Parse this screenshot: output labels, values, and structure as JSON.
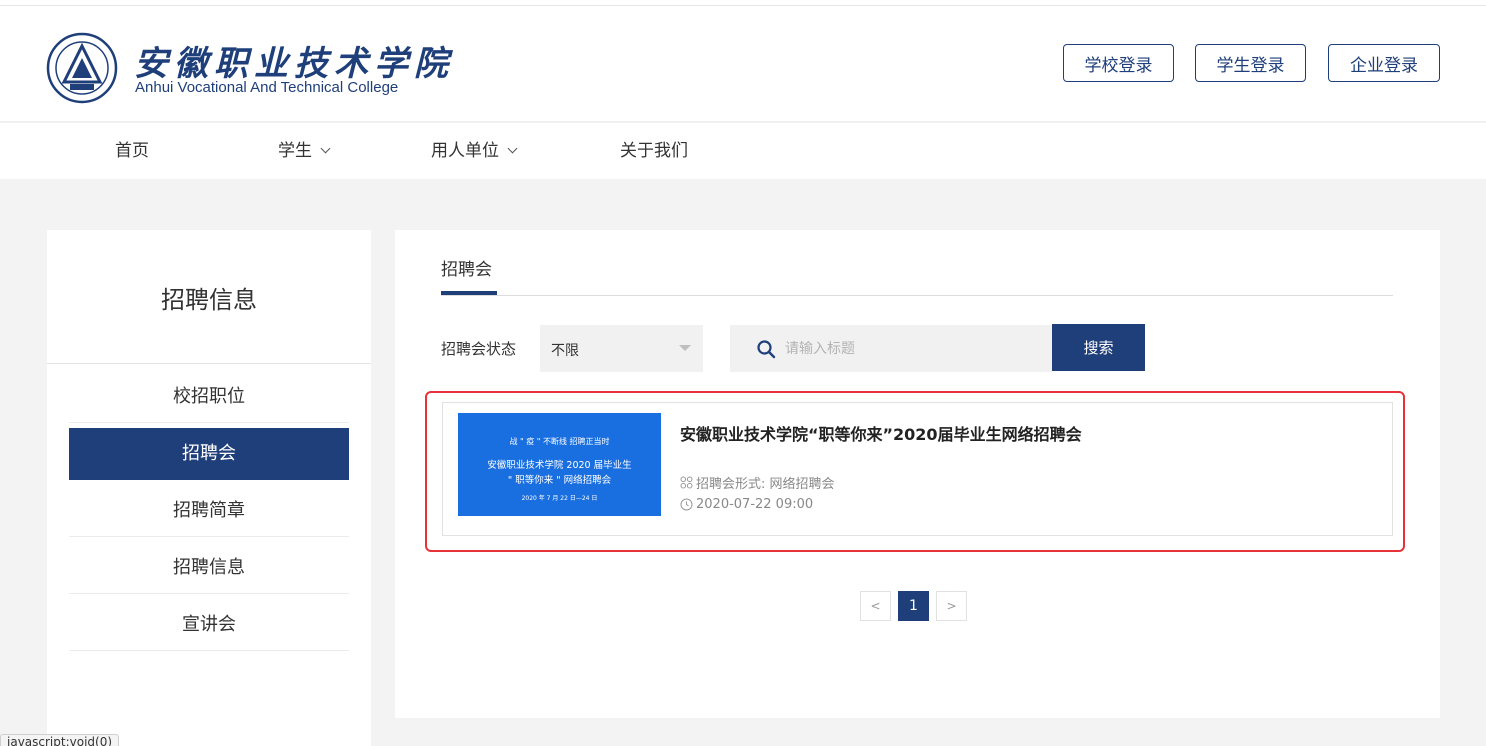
{
  "header": {
    "title_cn": "安徽职业技术学院",
    "title_en": "Anhui Vocational And Technical College",
    "login_buttons": [
      "学校登录",
      "学生登录",
      "企业登录"
    ]
  },
  "nav": {
    "items": [
      {
        "label": "首页",
        "dropdown": false
      },
      {
        "label": "学生",
        "dropdown": true
      },
      {
        "label": "用人单位",
        "dropdown": true
      },
      {
        "label": "关于我们",
        "dropdown": false
      }
    ]
  },
  "sidebar": {
    "title": "招聘信息",
    "items": [
      {
        "label": "校招职位",
        "active": false
      },
      {
        "label": "招聘会",
        "active": true
      },
      {
        "label": "招聘简章",
        "active": false
      },
      {
        "label": "招聘信息",
        "active": false
      },
      {
        "label": "宣讲会",
        "active": false
      }
    ]
  },
  "main": {
    "tab": "招聘会",
    "filter": {
      "label": "招聘会状态",
      "select_value": "不限",
      "search_placeholder": "请输入标题",
      "search_button": "搜索"
    },
    "fair": {
      "poster": {
        "line1": "战 \" 疫 \" 不断线   招聘正当时",
        "line2": "安徽职业技术学院 2020 届毕业生",
        "line3": "\" 职等你来 \" 网络招聘会",
        "line4": "2020 年 7 月 22 日—24 日"
      },
      "title": "安徽职业技术学院“职等你来”2020届毕业生网络招聘会",
      "format": "招聘会形式: 网络招聘会",
      "datetime": "2020-07-22 09:00"
    },
    "pagination": {
      "prev": "<",
      "current": "1",
      "next": ">"
    }
  },
  "status_bar": "javascript:void(0)",
  "colors": {
    "primary": "#1f3f7a",
    "highlight": "#e7323a",
    "poster": "#1a6fe0"
  },
  "icons": [
    "college-emblem-icon",
    "chevron-down-icon",
    "search-icon",
    "grid-icon",
    "clock-icon"
  ]
}
